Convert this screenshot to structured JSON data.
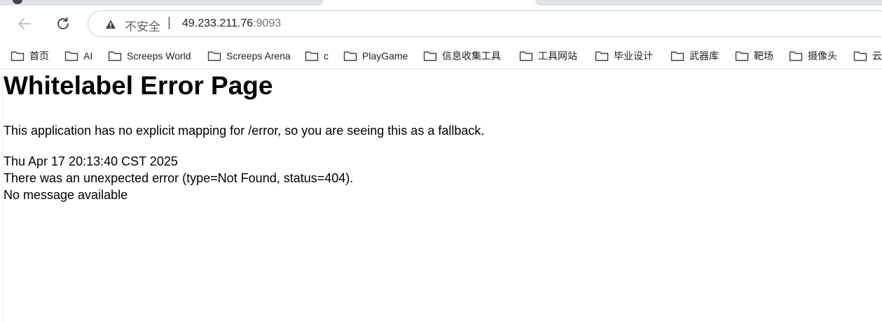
{
  "browser": {
    "security_label": "不安全",
    "separator": "|",
    "url_host": "49.233.211.76",
    "url_port": ":9093"
  },
  "bookmarks": [
    {
      "label": "首页",
      "icon": "folder-icon"
    },
    {
      "label": "AI",
      "icon": "folder-icon"
    },
    {
      "label": "Screeps World",
      "icon": "folder-icon"
    },
    {
      "label": "Screeps Arena",
      "icon": "folder-icon"
    },
    {
      "label": "c",
      "icon": "folder-icon"
    },
    {
      "label": "PlayGame",
      "icon": "folder-icon"
    },
    {
      "label": "信息收集工具",
      "icon": "folder-icon"
    },
    {
      "label": "工具网站",
      "icon": "folder-icon"
    },
    {
      "label": "毕业设计",
      "icon": "folder-icon"
    },
    {
      "label": "武器库",
      "icon": "folder-icon"
    },
    {
      "label": "靶场",
      "icon": "folder-icon"
    },
    {
      "label": "摄像头",
      "icon": "folder-icon"
    },
    {
      "label": "云",
      "icon": "folder-icon"
    }
  ],
  "page": {
    "title": "Whitelabel Error Page",
    "description": "This application has no explicit mapping for /error, so you are seeing this as a fallback.",
    "timestamp": "Thu Apr 17 20:13:40 CST 2025",
    "error_line": "There was an unexpected error (type=Not Found, status=404).",
    "message": "No message available"
  }
}
